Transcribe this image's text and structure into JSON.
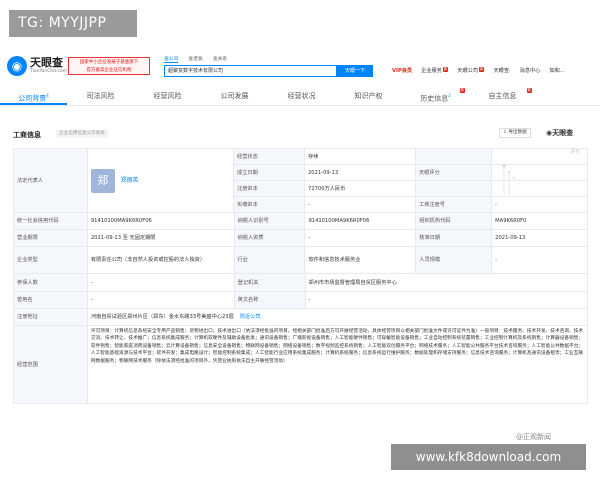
{
  "overlay": {
    "tag": "TG: MYYJJPP"
  },
  "header": {
    "logo_name": "天眼查",
    "logo_domain": "TianYanCha.com",
    "promo_line1": "国家中小企业发展子基金旗下",
    "promo_line2": "官方备案企业征信机构",
    "search_tabs": [
      "查公司",
      "查老板",
      "查关系"
    ],
    "search_value": "超聚变数字技术有限公司",
    "search_button": "天眼一下",
    "nav": {
      "vip": "VIP会员",
      "product": "企业服务",
      "app": "天眼公司",
      "corp": "天眼查·",
      "msg": "消息中心",
      "user": "如和..."
    },
    "badges": {
      "product": "新",
      "app": "新"
    }
  },
  "tabs": [
    {
      "label": "公司背景",
      "count": "4",
      "active": true
    },
    {
      "label": "司法风险"
    },
    {
      "label": "经营风险"
    },
    {
      "label": "公司发展"
    },
    {
      "label": "经营状况"
    },
    {
      "label": "知识产权"
    },
    {
      "label": "历史信息",
      "count": "2",
      "badge": "新"
    },
    {
      "label": "自主信息",
      "badge": "新"
    }
  ],
  "section": {
    "title": "工商信息",
    "hint": "企业信用信息公示系统",
    "download": "导出数据",
    "brand": "天眼查"
  },
  "info": {
    "legal_rep_label": "法定代表人",
    "legal_rep_avatar": "郑",
    "legal_rep_name": "郑丽英",
    "status_label": "经营状态",
    "status": "存续",
    "founded_label": "成立日期",
    "founded": "2021-09-13",
    "capital_label": "注册资本",
    "capital": "72700万人民币",
    "paid_label": "实缴资本",
    "paid": "-",
    "score_label": "天眼评分",
    "score_text": "评分",
    "regno_label": "工商注册号",
    "regno": "-",
    "credit_label": "统一社会信用代码",
    "credit": "91410100MA9K6R0F06",
    "taxid_label": "纳税人识别号",
    "taxid": "91410100MA9K6R0F06",
    "orgcode_label": "组织机构代码",
    "orgcode": "MA9K6R0F0",
    "term_label": "营业期限",
    "term": "2021-09-13 至 无固定期限",
    "taxpayer_label": "纳税人资质",
    "taxpayer": "-",
    "approve_label": "核准日期",
    "approve": "2021-09-13",
    "type_label": "企业类型",
    "type": "有限责任公司（非自然人投资或控股的法人独资）",
    "industry_label": "行业",
    "industry": "软件和信息技术服务业",
    "staff_label": "人员规模",
    "staff": "-",
    "insured_label": "参保人数",
    "insured": "-",
    "authority_label": "登记机关",
    "authority": "郑州市市场监督管理局自贸区服务中心",
    "former_label": "曾用名",
    "former": "-",
    "english_label": "英文名称",
    "english": "-",
    "address_label": "注册地址",
    "address": "河南自贸试验区郑州片区（郑东）金水东路33号美盛中心23层",
    "nearby": "附近公司",
    "scope_label": "经营范围",
    "scope": "许可项目：计算机信息系统安全专用产品销售；货物进出口；技术进出口（依法须经批准的项目，经相关部门批准后方可开展经营活动，具体经营项目以相关部门批准文件或许可证件为准）一般项目：技术服务、技术开发、技术咨询、技术交流、技术转让、技术推广；信息系统集成服务；计算机软硬件及辅助设备批发；通讯设备销售；广播影视设备销售；人工智能硬件销售；可穿戴智能设备销售；工业自动控制系统装置销售；工业控制计算机及系统销售；计算器设备销售；软件销售；智能家庭消费设备销售；云计算设备销售；信息安全设备销售；物联网设备销售；网络设备销售；数字视频监控系统销售；人工智能双创服务平台；网络技术服务；人工智能公共服务平台技术咨询服务；人工智能公共数据平台；人工智能基础资源与技术平台；软件开发；集成电路设计；智能控制系统集成；人工智能行业应用系统集成服务；计算机系统服务；信息系统运行维护服务；数据处理和存储支持服务；信息技术咨询服务；计算机及通讯设备租赁；工业互联网数据服务；物联网技术服务（除依法须经批准的项目外，凭营业执照依法自主开展经营活动）"
  },
  "watermark": "@正观新闻",
  "footer": "www.kfk8download.com"
}
